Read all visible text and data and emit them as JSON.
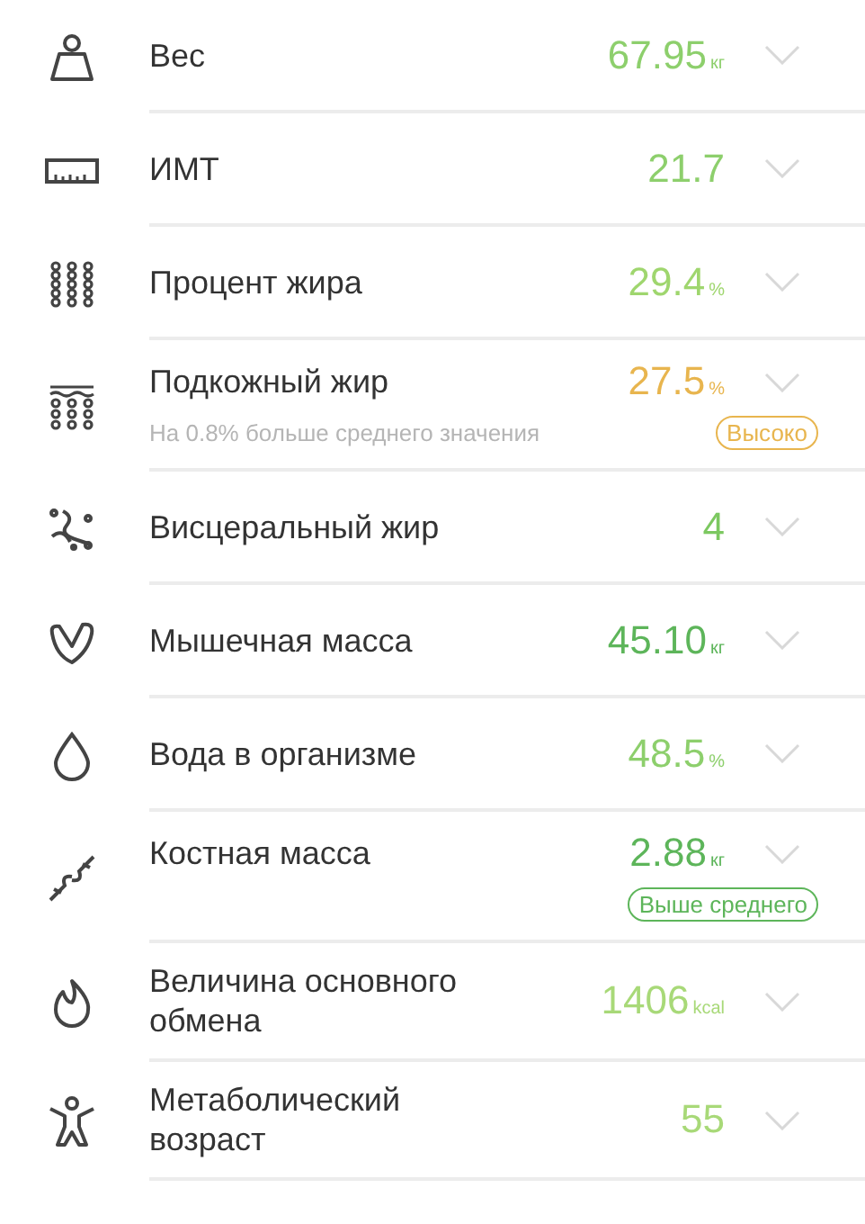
{
  "metrics": [
    {
      "kind": "weight",
      "label": "Вес",
      "value": "67.95",
      "unit": "кг",
      "color": "#8dcf6c"
    },
    {
      "kind": "bmi",
      "label": "ИМТ",
      "value": "21.7",
      "color": "#8dcf6c"
    },
    {
      "kind": "fat",
      "label": "Процент жира",
      "value": "29.4",
      "unit": "%",
      "color": "#9fd66e"
    },
    {
      "kind": "subcutaneous",
      "label": "Подкожный жир",
      "value": "27.5",
      "unit": "%",
      "color": "#e8b54e",
      "note": "На 0.8% больше среднего значения",
      "badge": "Высоко"
    },
    {
      "kind": "visceral",
      "label": "Висцеральный жир",
      "value": "4",
      "color": "#7cc860"
    },
    {
      "kind": "muscle",
      "label": "Мышечная масса",
      "value": "45.10",
      "unit": "кг",
      "color": "#5db55a"
    },
    {
      "kind": "water",
      "label": "Вода в организме",
      "value": "48.5",
      "unit": "%",
      "color": "#8dcf6c"
    },
    {
      "kind": "bone",
      "label": "Костная масса",
      "value": "2.88",
      "unit": "кг",
      "color": "#5db55a",
      "badge": "Выше среднего"
    },
    {
      "kind": "bmr",
      "label": "Величина основного обмена",
      "value": "1406",
      "unit": "kcal",
      "color": "#a8d978"
    },
    {
      "kind": "age",
      "label": "Метаболический возраст",
      "value": "55",
      "color": "#a8d978"
    }
  ]
}
